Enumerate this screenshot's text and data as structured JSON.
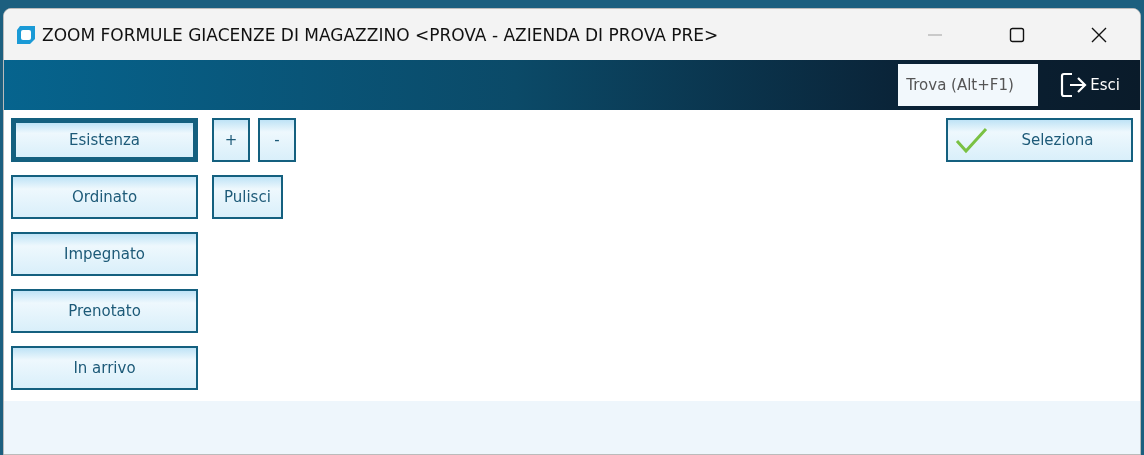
{
  "window": {
    "title": "ZOOM FORMULE GIACENZE DI MAGAZZINO <PROVA - AZIENDA DI PROVA PRE>"
  },
  "toolbar": {
    "search": {
      "placeholder": "Trova (Alt+F1)"
    },
    "exit": "Esci"
  },
  "formula_buttons": [
    {
      "label": "Esistenza",
      "focused": true
    },
    {
      "label": "Ordinato",
      "focused": false
    },
    {
      "label": "Impegnato",
      "focused": false
    },
    {
      "label": "Prenotato",
      "focused": false
    },
    {
      "label": "In arrivo",
      "focused": false
    }
  ],
  "operator_buttons": [
    "+",
    "-"
  ],
  "clear_button": "Pulisci",
  "select_button": "Seleziona"
}
